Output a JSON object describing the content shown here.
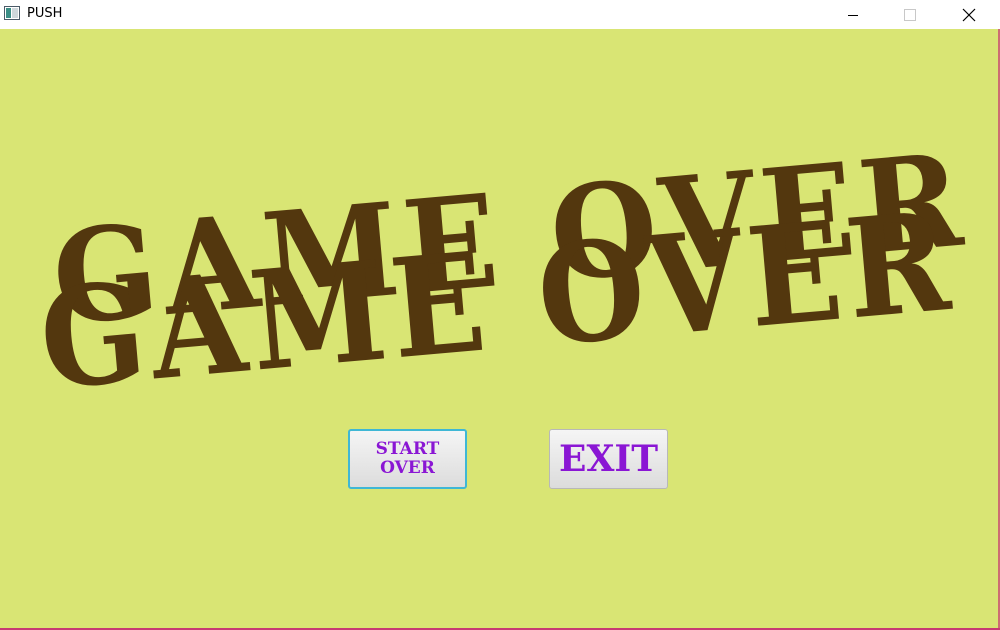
{
  "window": {
    "title": "PUSH",
    "controls": {
      "minimize_icon": "minimize-icon",
      "maximize_icon": "maximize-icon",
      "close_icon": "close-icon"
    }
  },
  "game": {
    "headline_back": "GAME OVER",
    "headline_front": "GAME OVER",
    "start_over_label": "START\nOVER",
    "exit_label": "EXIT"
  },
  "colors": {
    "background": "#d9e574",
    "headline": "#53370e",
    "button_text": "#8a16d4",
    "focus_border": "#3fb7d5",
    "window_border": "#c73a73"
  }
}
